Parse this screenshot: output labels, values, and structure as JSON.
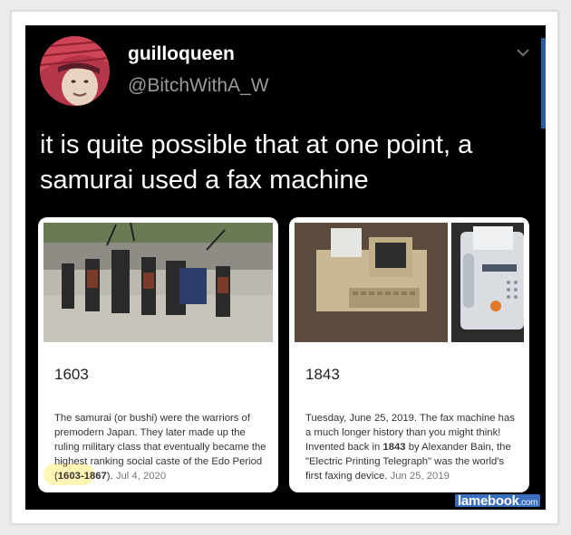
{
  "tweet": {
    "display_name": "guilloqueen",
    "handle": "@BitchWithA_W",
    "text_line1": "it is quite possible that at one point, a",
    "text_line2": "samurai used a fax machine",
    "menu_icon": "chevron-down-icon"
  },
  "cards": [
    {
      "year": "1603",
      "image": "samurai procession photo",
      "desc_parts": [
        {
          "text": "The samurai (or bushi) were the warriors of premodern Japan. They later made up the ruling military class that eventually became the highest ranking social caste of the Edo Period (",
          "bold": false
        },
        {
          "text": "1603-1867",
          "bold": true
        },
        {
          "text": "). ",
          "bold": false
        }
      ],
      "date": "Jul 4, 2020"
    },
    {
      "year": "1843",
      "image": "vintage fax machine photos",
      "desc_parts": [
        {
          "text": "Tuesday, June 25, 2019. The fax machine has a much longer history than you might think! Invented back in ",
          "bold": false
        },
        {
          "text": "1843",
          "bold": true
        },
        {
          "text": " by Alexander Bain, the \"Electric Printing Telegraph\" was the world's first faxing device. ",
          "bold": false
        }
      ],
      "date": "Jun 25, 2019"
    }
  ],
  "watermark": {
    "brand": "lamebook",
    "suffix": ".com"
  },
  "colors": {
    "background": "#000000",
    "handle": "#9a9a9a",
    "watermark": "#3a6fbf"
  }
}
